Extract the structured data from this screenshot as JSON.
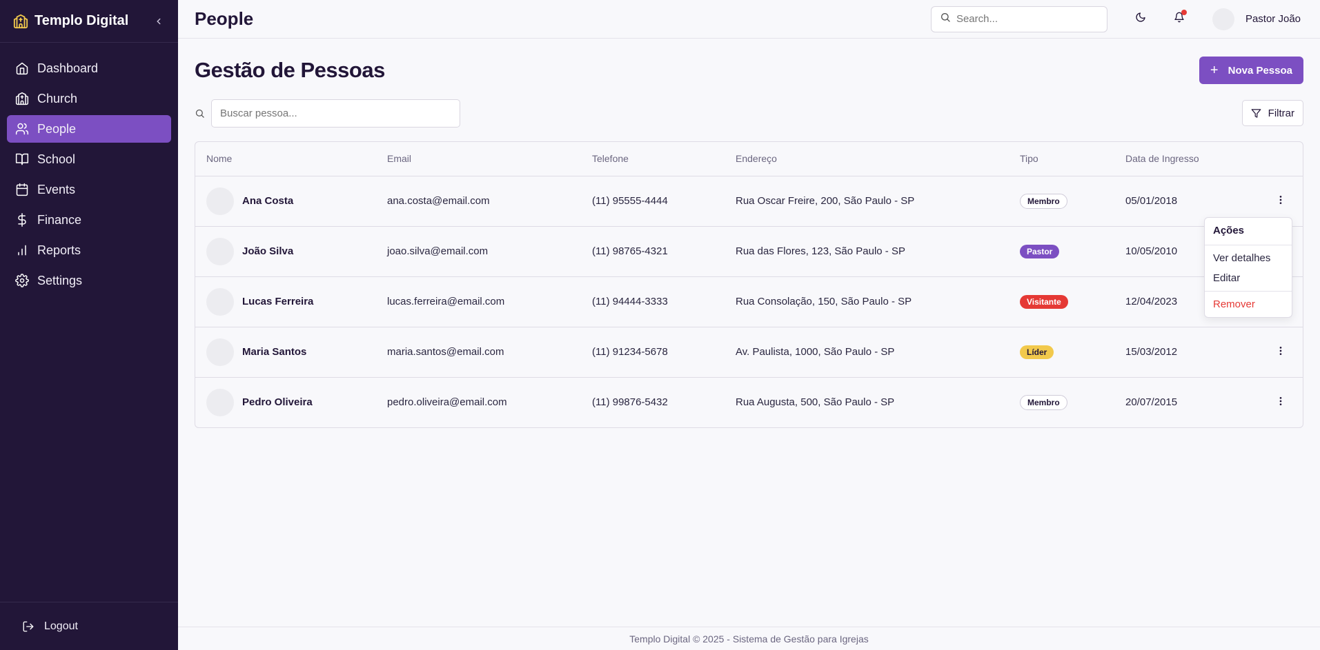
{
  "sidebar": {
    "brand": "Templo Digital",
    "items": [
      {
        "label": "Dashboard",
        "icon": "home-icon"
      },
      {
        "label": "Church",
        "icon": "church-icon"
      },
      {
        "label": "People",
        "icon": "users-icon"
      },
      {
        "label": "School",
        "icon": "book-icon"
      },
      {
        "label": "Events",
        "icon": "calendar-icon"
      },
      {
        "label": "Finance",
        "icon": "dollar-icon"
      },
      {
        "label": "Reports",
        "icon": "bar-chart-icon"
      },
      {
        "label": "Settings",
        "icon": "gear-icon"
      }
    ],
    "active_item": "People",
    "logout_label": "Logout"
  },
  "header": {
    "page_title": "People",
    "search_placeholder": "Search...",
    "user_name": "Pastor João"
  },
  "main": {
    "title": "Gestão de Pessoas",
    "new_button": "Nova Pessoa",
    "search_placeholder": "Buscar pessoa...",
    "filter_button": "Filtrar",
    "columns": [
      "Nome",
      "Email",
      "Telefone",
      "Endereço",
      "Tipo",
      "Data de Ingresso"
    ],
    "rows": [
      {
        "name": "Ana Costa",
        "email": "ana.costa@email.com",
        "phone": "(11) 95555-4444",
        "address": "Rua Oscar Freire, 200, São Paulo - SP",
        "type": "Membro",
        "date": "05/01/2018"
      },
      {
        "name": "João Silva",
        "email": "joao.silva@email.com",
        "phone": "(11) 98765-4321",
        "address": "Rua das Flores, 123, São Paulo - SP",
        "type": "Pastor",
        "date": "10/05/2010"
      },
      {
        "name": "Lucas Ferreira",
        "email": "lucas.ferreira@email.com",
        "phone": "(11) 94444-3333",
        "address": "Rua Consolação, 150, São Paulo - SP",
        "type": "Visitante",
        "date": "12/04/2023"
      },
      {
        "name": "Maria Santos",
        "email": "maria.santos@email.com",
        "phone": "(11) 91234-5678",
        "address": "Av. Paulista, 1000, São Paulo - SP",
        "type": "Líder",
        "date": "15/03/2012"
      },
      {
        "name": "Pedro Oliveira",
        "email": "pedro.oliveira@email.com",
        "phone": "(11) 99876-5432",
        "address": "Rua Augusta, 500, São Paulo - SP",
        "type": "Membro",
        "date": "20/07/2015"
      }
    ]
  },
  "dropdown": {
    "title": "Ações",
    "view": "Ver detalhes",
    "edit": "Editar",
    "remove": "Remover"
  },
  "footer": {
    "text": "Templo Digital © 2025 - Sistema de Gestão para Igrejas"
  },
  "colors": {
    "sidebar_bg": "#221638",
    "accent": "#7c4fc2",
    "danger": "#e53935",
    "leader_badge": "#f2c94c"
  }
}
